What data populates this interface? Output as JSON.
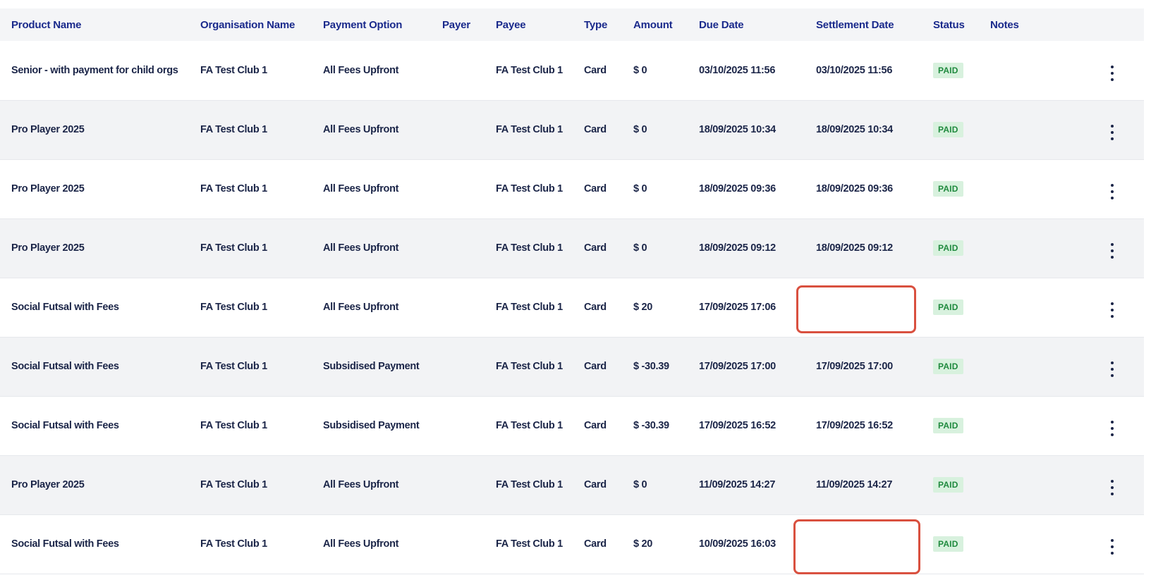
{
  "columns": {
    "product_name": "Product Name",
    "organisation_name": "Organisation Name",
    "payment_option": "Payment Option",
    "payer": "Payer",
    "payee": "Payee",
    "type": "Type",
    "amount": "Amount",
    "due_date": "Due Date",
    "settlement_date": "Settlement Date",
    "status": "Status",
    "notes": "Notes"
  },
  "rows": [
    {
      "product": "Senior - with payment for child orgs",
      "org": "FA Test Club 1",
      "payment_option": "All Fees Upfront",
      "payer": "",
      "payee": "FA Test Club 1",
      "type": "Card",
      "amount": "$ 0",
      "due_date": "03/10/2025 11:56",
      "settlement_date": "03/10/2025 11:56",
      "status": "PAID",
      "notes": ""
    },
    {
      "product": "Pro Player 2025",
      "org": "FA Test Club 1",
      "payment_option": "All Fees Upfront",
      "payer": "",
      "payee": "FA Test Club 1",
      "type": "Card",
      "amount": "$ 0",
      "due_date": "18/09/2025 10:34",
      "settlement_date": "18/09/2025 10:34",
      "status": "PAID",
      "notes": ""
    },
    {
      "product": "Pro Player 2025",
      "org": "FA Test Club 1",
      "payment_option": "All Fees Upfront",
      "payer": "",
      "payee": "FA Test Club 1",
      "type": "Card",
      "amount": "$ 0",
      "due_date": "18/09/2025 09:36",
      "settlement_date": "18/09/2025 09:36",
      "status": "PAID",
      "notes": ""
    },
    {
      "product": "Pro Player 2025",
      "org": "FA Test Club 1",
      "payment_option": "All Fees Upfront",
      "payer": "",
      "payee": "FA Test Club 1",
      "type": "Card",
      "amount": "$ 0",
      "due_date": "18/09/2025 09:12",
      "settlement_date": "18/09/2025 09:12",
      "status": "PAID",
      "notes": ""
    },
    {
      "product": "Social Futsal with Fees",
      "org": "FA Test Club 1",
      "payment_option": "All Fees Upfront",
      "payer": "",
      "payee": "FA Test Club 1",
      "type": "Card",
      "amount": "$ 20",
      "due_date": "17/09/2025 17:06",
      "settlement_date": "",
      "status": "PAID",
      "notes": ""
    },
    {
      "product": "Social Futsal with Fees",
      "org": "FA Test Club 1",
      "payment_option": "Subsidised Payment",
      "payer": "",
      "payee": "FA Test Club 1",
      "type": "Card",
      "amount": "$ -30.39",
      "due_date": "17/09/2025 17:00",
      "settlement_date": "17/09/2025 17:00",
      "status": "PAID",
      "notes": ""
    },
    {
      "product": "Social Futsal with Fees",
      "org": "FA Test Club 1",
      "payment_option": "Subsidised Payment",
      "payer": "",
      "payee": "FA Test Club 1",
      "type": "Card",
      "amount": "$ -30.39",
      "due_date": "17/09/2025 16:52",
      "settlement_date": "17/09/2025 16:52",
      "status": "PAID",
      "notes": ""
    },
    {
      "product": "Pro Player 2025",
      "org": "FA Test Club 1",
      "payment_option": "All Fees Upfront",
      "payer": "",
      "payee": "FA Test Club 1",
      "type": "Card",
      "amount": "$ 0",
      "due_date": "11/09/2025 14:27",
      "settlement_date": "11/09/2025 14:27",
      "status": "PAID",
      "notes": ""
    },
    {
      "product": "Social Futsal with Fees",
      "org": "FA Test Club 1",
      "payment_option": "All Fees Upfront",
      "payer": "",
      "payee": "FA Test Club 1",
      "type": "Card",
      "amount": "$ 20",
      "due_date": "10/09/2025 16:03",
      "settlement_date": "",
      "status": "PAID",
      "notes": ""
    }
  ],
  "colors": {
    "header_text": "#1a2a8c",
    "cell_text": "#1b2548",
    "paid_badge_bg": "#d8f1de",
    "paid_badge_text": "#1f8a3e",
    "highlight_border": "#d9503f",
    "row_alt_bg": "#f2f3f5"
  },
  "icons": {
    "row_actions": "more-vertical-icon"
  }
}
